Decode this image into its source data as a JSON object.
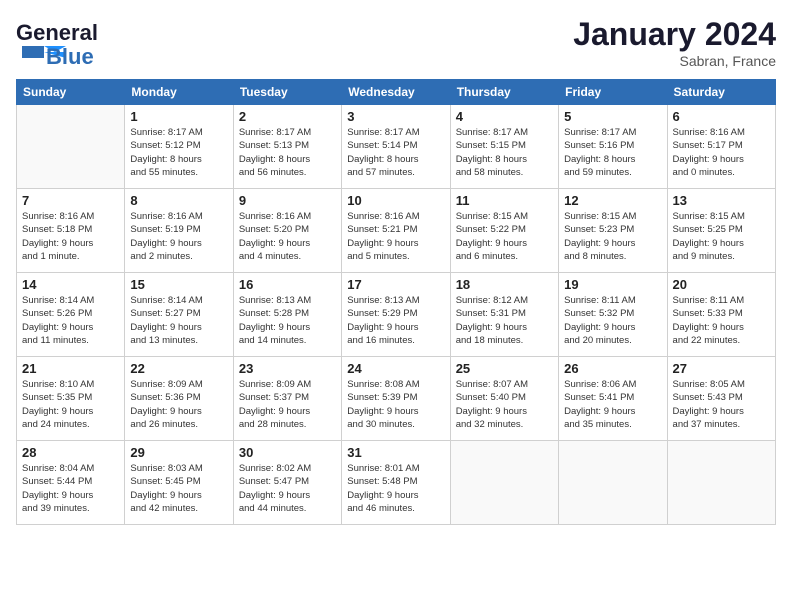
{
  "header": {
    "logo_line1": "General",
    "logo_line2": "Blue",
    "month": "January 2024",
    "location": "Sabran, France"
  },
  "days_of_week": [
    "Sunday",
    "Monday",
    "Tuesday",
    "Wednesday",
    "Thursday",
    "Friday",
    "Saturday"
  ],
  "weeks": [
    [
      {
        "day": "",
        "info": ""
      },
      {
        "day": "1",
        "info": "Sunrise: 8:17 AM\nSunset: 5:12 PM\nDaylight: 8 hours\nand 55 minutes."
      },
      {
        "day": "2",
        "info": "Sunrise: 8:17 AM\nSunset: 5:13 PM\nDaylight: 8 hours\nand 56 minutes."
      },
      {
        "day": "3",
        "info": "Sunrise: 8:17 AM\nSunset: 5:14 PM\nDaylight: 8 hours\nand 57 minutes."
      },
      {
        "day": "4",
        "info": "Sunrise: 8:17 AM\nSunset: 5:15 PM\nDaylight: 8 hours\nand 58 minutes."
      },
      {
        "day": "5",
        "info": "Sunrise: 8:17 AM\nSunset: 5:16 PM\nDaylight: 8 hours\nand 59 minutes."
      },
      {
        "day": "6",
        "info": "Sunrise: 8:16 AM\nSunset: 5:17 PM\nDaylight: 9 hours\nand 0 minutes."
      }
    ],
    [
      {
        "day": "7",
        "info": "Sunrise: 8:16 AM\nSunset: 5:18 PM\nDaylight: 9 hours\nand 1 minute."
      },
      {
        "day": "8",
        "info": "Sunrise: 8:16 AM\nSunset: 5:19 PM\nDaylight: 9 hours\nand 2 minutes."
      },
      {
        "day": "9",
        "info": "Sunrise: 8:16 AM\nSunset: 5:20 PM\nDaylight: 9 hours\nand 4 minutes."
      },
      {
        "day": "10",
        "info": "Sunrise: 8:16 AM\nSunset: 5:21 PM\nDaylight: 9 hours\nand 5 minutes."
      },
      {
        "day": "11",
        "info": "Sunrise: 8:15 AM\nSunset: 5:22 PM\nDaylight: 9 hours\nand 6 minutes."
      },
      {
        "day": "12",
        "info": "Sunrise: 8:15 AM\nSunset: 5:23 PM\nDaylight: 9 hours\nand 8 minutes."
      },
      {
        "day": "13",
        "info": "Sunrise: 8:15 AM\nSunset: 5:25 PM\nDaylight: 9 hours\nand 9 minutes."
      }
    ],
    [
      {
        "day": "14",
        "info": "Sunrise: 8:14 AM\nSunset: 5:26 PM\nDaylight: 9 hours\nand 11 minutes."
      },
      {
        "day": "15",
        "info": "Sunrise: 8:14 AM\nSunset: 5:27 PM\nDaylight: 9 hours\nand 13 minutes."
      },
      {
        "day": "16",
        "info": "Sunrise: 8:13 AM\nSunset: 5:28 PM\nDaylight: 9 hours\nand 14 minutes."
      },
      {
        "day": "17",
        "info": "Sunrise: 8:13 AM\nSunset: 5:29 PM\nDaylight: 9 hours\nand 16 minutes."
      },
      {
        "day": "18",
        "info": "Sunrise: 8:12 AM\nSunset: 5:31 PM\nDaylight: 9 hours\nand 18 minutes."
      },
      {
        "day": "19",
        "info": "Sunrise: 8:11 AM\nSunset: 5:32 PM\nDaylight: 9 hours\nand 20 minutes."
      },
      {
        "day": "20",
        "info": "Sunrise: 8:11 AM\nSunset: 5:33 PM\nDaylight: 9 hours\nand 22 minutes."
      }
    ],
    [
      {
        "day": "21",
        "info": "Sunrise: 8:10 AM\nSunset: 5:35 PM\nDaylight: 9 hours\nand 24 minutes."
      },
      {
        "day": "22",
        "info": "Sunrise: 8:09 AM\nSunset: 5:36 PM\nDaylight: 9 hours\nand 26 minutes."
      },
      {
        "day": "23",
        "info": "Sunrise: 8:09 AM\nSunset: 5:37 PM\nDaylight: 9 hours\nand 28 minutes."
      },
      {
        "day": "24",
        "info": "Sunrise: 8:08 AM\nSunset: 5:39 PM\nDaylight: 9 hours\nand 30 minutes."
      },
      {
        "day": "25",
        "info": "Sunrise: 8:07 AM\nSunset: 5:40 PM\nDaylight: 9 hours\nand 32 minutes."
      },
      {
        "day": "26",
        "info": "Sunrise: 8:06 AM\nSunset: 5:41 PM\nDaylight: 9 hours\nand 35 minutes."
      },
      {
        "day": "27",
        "info": "Sunrise: 8:05 AM\nSunset: 5:43 PM\nDaylight: 9 hours\nand 37 minutes."
      }
    ],
    [
      {
        "day": "28",
        "info": "Sunrise: 8:04 AM\nSunset: 5:44 PM\nDaylight: 9 hours\nand 39 minutes."
      },
      {
        "day": "29",
        "info": "Sunrise: 8:03 AM\nSunset: 5:45 PM\nDaylight: 9 hours\nand 42 minutes."
      },
      {
        "day": "30",
        "info": "Sunrise: 8:02 AM\nSunset: 5:47 PM\nDaylight: 9 hours\nand 44 minutes."
      },
      {
        "day": "31",
        "info": "Sunrise: 8:01 AM\nSunset: 5:48 PM\nDaylight: 9 hours\nand 46 minutes."
      },
      {
        "day": "",
        "info": ""
      },
      {
        "day": "",
        "info": ""
      },
      {
        "day": "",
        "info": ""
      }
    ]
  ]
}
